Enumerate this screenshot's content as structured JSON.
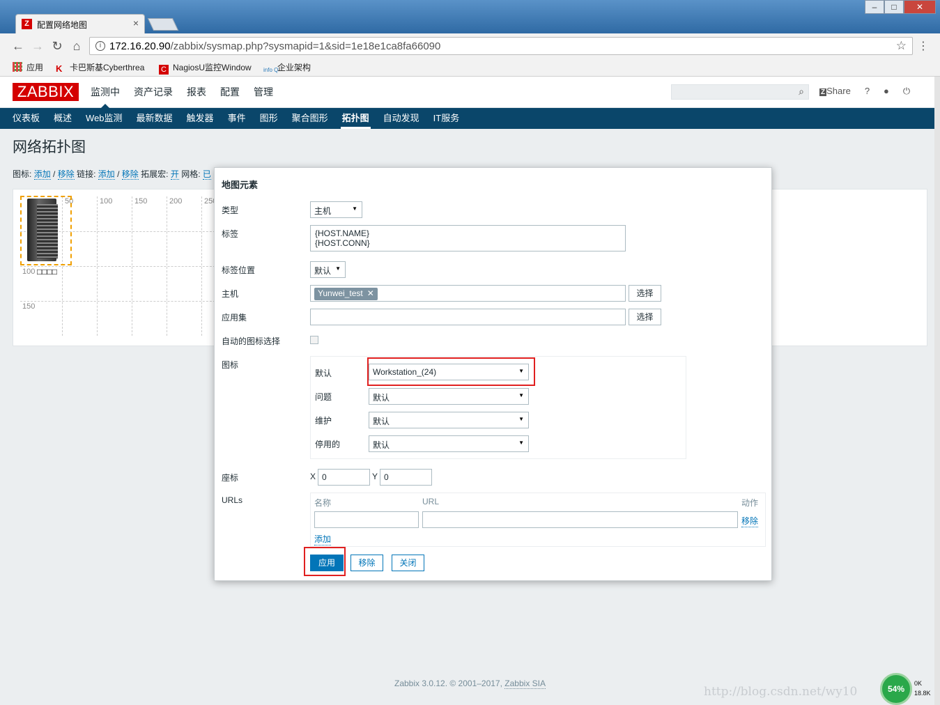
{
  "browser": {
    "tab_title": "配置网络地图",
    "url_host": "172.16.20.90",
    "url_path": "/zabbix/sysmap.php?sysmapid=1&sid=1e18e1ca8fa66090",
    "bookmarks": [
      "应用",
      "卡巴斯基Cyberthrea",
      "NagiosU监控Window",
      "企业架构"
    ]
  },
  "header": {
    "logo": "ZABBIX",
    "menu": [
      "监测中",
      "资产记录",
      "报表",
      "配置",
      "管理"
    ],
    "share": "Share",
    "help": "?"
  },
  "subnav": [
    "仪表板",
    "概述",
    "Web监测",
    "最新数据",
    "触发器",
    "事件",
    "图形",
    "聚合图形",
    "拓扑图",
    "自动发现",
    "IT服务"
  ],
  "page_title": "网络拓扑图",
  "controls": {
    "icon_label": "图标:",
    "add": "添加",
    "remove": "移除",
    "link_label": "链接:",
    "expand_macro": "拓展宏:",
    "on": "开",
    "grid_label": "网格:",
    "grid_val": "已"
  },
  "map": {
    "ticks_x": [
      "50",
      "100",
      "150",
      "200",
      "250"
    ],
    "ticks_y": [
      "100",
      "150"
    ],
    "element_label": "□□□□"
  },
  "dialog": {
    "title": "地图元素",
    "type_label": "类型",
    "type_value": "主机",
    "label_label": "标签",
    "label_value_1": "{HOST.NAME}",
    "label_value_2": "{HOST.CONN}",
    "label_pos_label": "标签位置",
    "label_pos_value": "默认",
    "host_label": "主机",
    "host_tag": "Yunwei_test",
    "select_btn": "选择",
    "appset_label": "应用集",
    "auto_icon_label": "自动的图标选择",
    "icons_label": "图标",
    "icon_rows": [
      {
        "label": "默认",
        "value": "Workstation_(24)"
      },
      {
        "label": "问题",
        "value": "默认"
      },
      {
        "label": "维护",
        "value": "默认"
      },
      {
        "label": "停用的",
        "value": "默认"
      }
    ],
    "coords_label": "座标",
    "x_label": "X",
    "x_value": "0",
    "y_label": "Y",
    "y_value": "0",
    "urls_label": "URLs",
    "col_name": "名称",
    "col_url": "URL",
    "col_action": "动作",
    "remove_link": "移除",
    "add_link": "添加",
    "apply_btn": "应用",
    "remove_btn": "移除",
    "close_btn": "关闭"
  },
  "footer": {
    "text": "Zabbix 3.0.12. © 2001–2017,",
    "company": "Zabbix SIA"
  },
  "overlay": {
    "watermark": "http://blog.csdn.net/wy10",
    "gauge": "54%",
    "speed_up": "0K",
    "speed_down": "18.8K"
  },
  "colors": {
    "brand": "#d40000",
    "nav": "#0a466a",
    "primary": "#0275b8",
    "highlight": "#e02020"
  }
}
